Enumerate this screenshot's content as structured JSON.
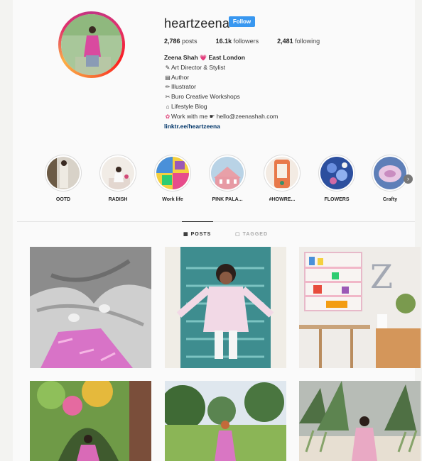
{
  "profile": {
    "username": "heartzeena",
    "follow_label": "Follow",
    "stats": {
      "posts": "2,786",
      "posts_label": "posts",
      "followers": "16.1k",
      "followers_label": "followers",
      "following": "2,481",
      "following_label": "following"
    },
    "bio": {
      "name": "Zeena Shah",
      "heart_icon": "💗",
      "location": "East London",
      "lines": [
        "Art Director & Stylist",
        "Author",
        "Illustrator",
        "Buro Creative Workshops",
        "Lifestyle Blog"
      ],
      "work_prefix": "Work with me",
      "email": "hello@zeenashah.com",
      "link": "linktr.ee/heartzeena"
    }
  },
  "highlights": [
    {
      "label": "OOTD"
    },
    {
      "label": "RADISH"
    },
    {
      "label": "Work life"
    },
    {
      "label": "PINK PALA..."
    },
    {
      "label": "#HOWRE..."
    },
    {
      "label": "FLOWERS"
    },
    {
      "label": "Crafty"
    }
  ],
  "tabs": {
    "posts": "POSTS",
    "tagged": "TAGGED"
  },
  "icons": {
    "highlights_next": "chevron-right-icon",
    "posts_tab": "grid-icon",
    "tagged_tab": "tag-icon"
  },
  "colors": {
    "follow": "#3897f0",
    "link": "#003569"
  }
}
